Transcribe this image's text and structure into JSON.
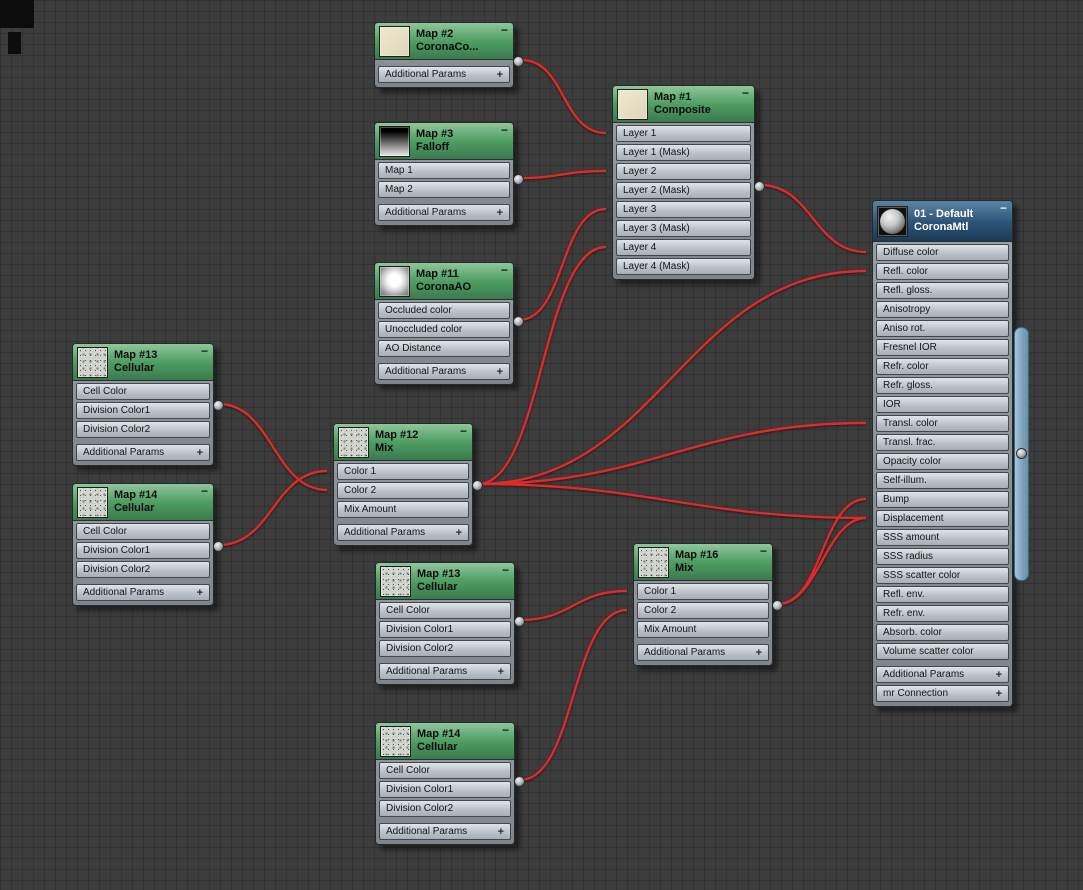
{
  "app": {
    "view": "Slate Material Editor node view"
  },
  "ui": {
    "collapse": "−",
    "plus": "+"
  },
  "colors": {
    "background": "#3c3c3c",
    "grid": "#333333",
    "wire": "#e22828",
    "map_header_green": "#4f9e63",
    "material_header_blue": "#2c5377",
    "slot_bg": "#c3cad1",
    "selection_bar_blue": "#8fb6d0"
  },
  "nodes": {
    "map2": {
      "title": "Map #2",
      "subtitle": "CoronaCo...",
      "slots": [],
      "footers": [
        "Additional Params"
      ]
    },
    "map3": {
      "title": "Map #3",
      "subtitle": "Falloff",
      "slots": [
        "Map 1",
        "Map 2"
      ],
      "footers": [
        "Additional Params"
      ]
    },
    "map1": {
      "title": "Map #1",
      "subtitle": "Composite",
      "slots": [
        "Layer 1",
        "Layer 1 (Mask)",
        "Layer 2",
        "Layer 2 (Mask)",
        "Layer 3",
        "Layer 3 (Mask)",
        "Layer 4",
        "Layer 4 (Mask)"
      ],
      "footers": []
    },
    "map11": {
      "title": "Map #11",
      "subtitle": "CoronaAO",
      "slots": [
        "Occluded color",
        "Unoccluded color",
        "AO Distance"
      ],
      "footers": [
        "Additional Params"
      ]
    },
    "map13a": {
      "title": "Map #13",
      "subtitle": "Cellular",
      "slots": [
        "Cell Color",
        "Division Color1",
        "Division Color2"
      ],
      "footers": [
        "Additional Params"
      ]
    },
    "map14a": {
      "title": "Map #14",
      "subtitle": "Cellular",
      "slots": [
        "Cell Color",
        "Division Color1",
        "Division Color2"
      ],
      "footers": [
        "Additional Params"
      ]
    },
    "map12": {
      "title": "Map #12",
      "subtitle": "Mix",
      "slots": [
        "Color 1",
        "Color 2",
        "Mix Amount"
      ],
      "footers": [
        "Additional Params"
      ]
    },
    "map13b": {
      "title": "Map #13",
      "subtitle": "Cellular",
      "slots": [
        "Cell Color",
        "Division Color1",
        "Division Color2"
      ],
      "footers": [
        "Additional Params"
      ]
    },
    "map16": {
      "title": "Map #16",
      "subtitle": "Mix",
      "slots": [
        "Color 1",
        "Color 2",
        "Mix Amount"
      ],
      "footers": [
        "Additional Params"
      ]
    },
    "map14b": {
      "title": "Map #14",
      "subtitle": "Cellular",
      "slots": [
        "Cell Color",
        "Division Color1",
        "Division Color2"
      ],
      "footers": [
        "Additional Params"
      ]
    },
    "material": {
      "title": "01 - Default",
      "subtitle": "CoronaMtl",
      "slots": [
        "Diffuse color",
        "Refl. color",
        "Refl. gloss.",
        "Anisotropy",
        "Aniso rot.",
        "Fresnel IOR",
        "Refr. color",
        "Refr. gloss.",
        "IOR",
        "Transl. color",
        "Transl. frac.",
        "Opacity color",
        "Self-illum.",
        "Bump",
        "Displacement",
        "SSS amount",
        "SSS radius",
        "SSS scatter color",
        "Refl. env.",
        "Refr. env.",
        "Absorb. color",
        "Volume scatter color"
      ],
      "footers": [
        "Additional Params",
        "mr Connection"
      ]
    }
  },
  "connections": [
    {
      "from": "Map #2 (CoronaCo...)",
      "to": "Map #1 : Layer 1"
    },
    {
      "from": "Map #3 (Falloff)",
      "to": "Map #1 : Layer 2"
    },
    {
      "from": "Map #11 (CoronaAO)",
      "to": "Map #1 : Layer 3"
    },
    {
      "from": "Map #12 (Mix)",
      "to": "Map #1 : Layer 4"
    },
    {
      "from": "Map #1 (Composite)",
      "to": "CoronaMtl : Diffuse color"
    },
    {
      "from": "Map #12 (Mix)",
      "to": "CoronaMtl : Refl. color"
    },
    {
      "from": "Map #12 (Mix)",
      "to": "CoronaMtl : Transl. color"
    },
    {
      "from": "Map #12 (Mix)",
      "to": "CoronaMtl : Displacement"
    },
    {
      "from": "Map #16 (Mix)",
      "to": "CoronaMtl : Bump"
    },
    {
      "from": "Map #16 (Mix)",
      "to": "CoronaMtl : Displacement"
    },
    {
      "from": "Map #13 (Cellular)",
      "to": "Map #12 : Color 2"
    },
    {
      "from": "Map #14 (Cellular)",
      "to": "Map #12 : Color 1"
    },
    {
      "from": "Map #13 (Cellular)",
      "to": "Map #16 : Color 1"
    },
    {
      "from": "Map #14 (Cellular)",
      "to": "Map #16 : Color 2"
    }
  ]
}
